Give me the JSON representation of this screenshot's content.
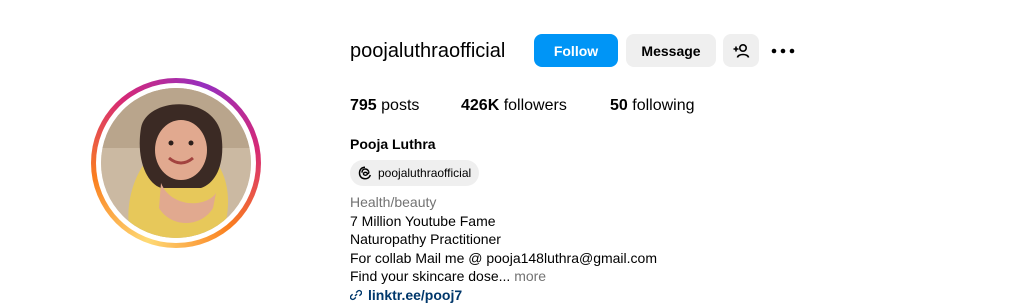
{
  "profile": {
    "username": "poojaluthraofficial",
    "full_name": "Pooja Luthra",
    "avatar_icon": "profile-photo"
  },
  "actions": {
    "follow_label": "Follow",
    "message_label": "Message",
    "add_user_icon": "person-add-icon",
    "more_icon": "ellipsis-icon"
  },
  "stats": {
    "posts_count": "795",
    "posts_label": "posts",
    "followers_count": "426K",
    "followers_label": "followers",
    "following_count": "50",
    "following_label": "following"
  },
  "threads": {
    "handle": "poojaluthraofficial",
    "icon": "threads-icon"
  },
  "bio": {
    "category": "Health/beauty",
    "lines": [
      "7 Million Youtube Fame",
      "Naturopathy Practitioner",
      "For collab Mail me @ pooja148luthra@gmail.com"
    ],
    "truncated_line": "Find your skincare dose...",
    "more_label": "more",
    "link_text": "linktr.ee/pooj7",
    "link_icon": "link-icon"
  },
  "colors": {
    "primary_button": "#0095f6",
    "secondary_button": "#efefef",
    "link": "#00376b",
    "muted": "#737373"
  }
}
